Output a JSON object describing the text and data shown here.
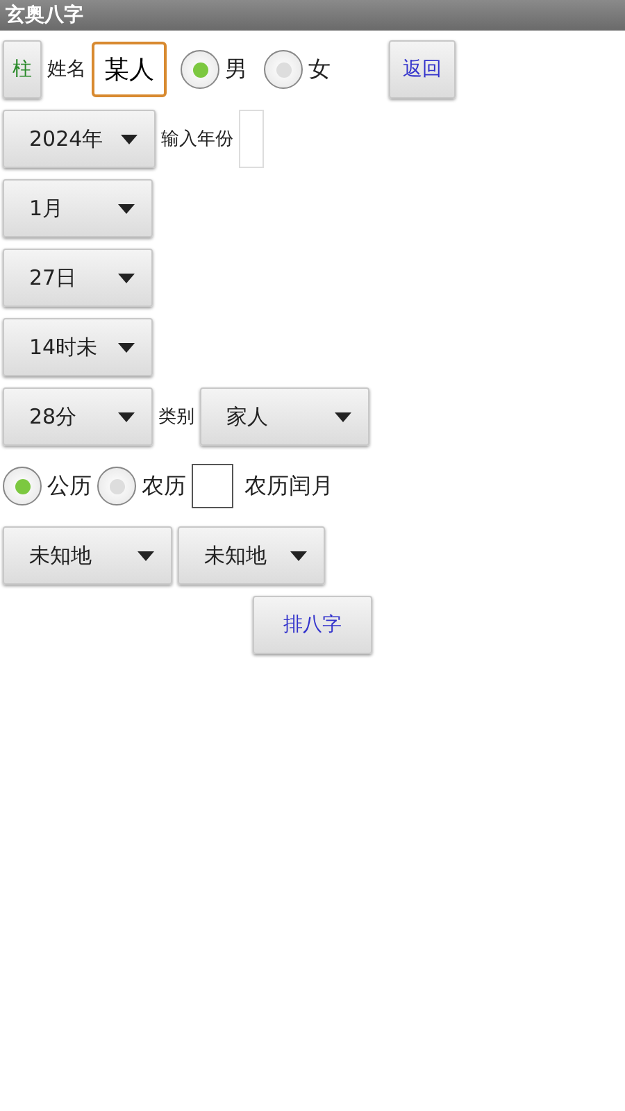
{
  "window": {
    "title": "玄奥八字"
  },
  "top_row": {
    "pillar_button": "柱",
    "name_label": "姓名",
    "name_value": "某人",
    "genders": [
      {
        "label": "男",
        "selected": true
      },
      {
        "label": "女",
        "selected": false
      }
    ],
    "back_button": "返回"
  },
  "year": {
    "spinner": "2024年",
    "input_label": "输入年份"
  },
  "spinners": [
    {
      "value": "1月"
    },
    {
      "value": "27日"
    },
    {
      "value": "14时未"
    }
  ],
  "minute_row": {
    "spinner": "28分",
    "category_label": "类别",
    "category": "家人"
  },
  "calendars": [
    {
      "label": "公历",
      "selected": true
    },
    {
      "label": "农历",
      "selected": false
    }
  ],
  "leap_month": {
    "label": "农历闰月",
    "checked": false
  },
  "places": [
    {
      "value": "未知地"
    },
    {
      "value": "未知地"
    }
  ],
  "submit_button": "排八字"
}
